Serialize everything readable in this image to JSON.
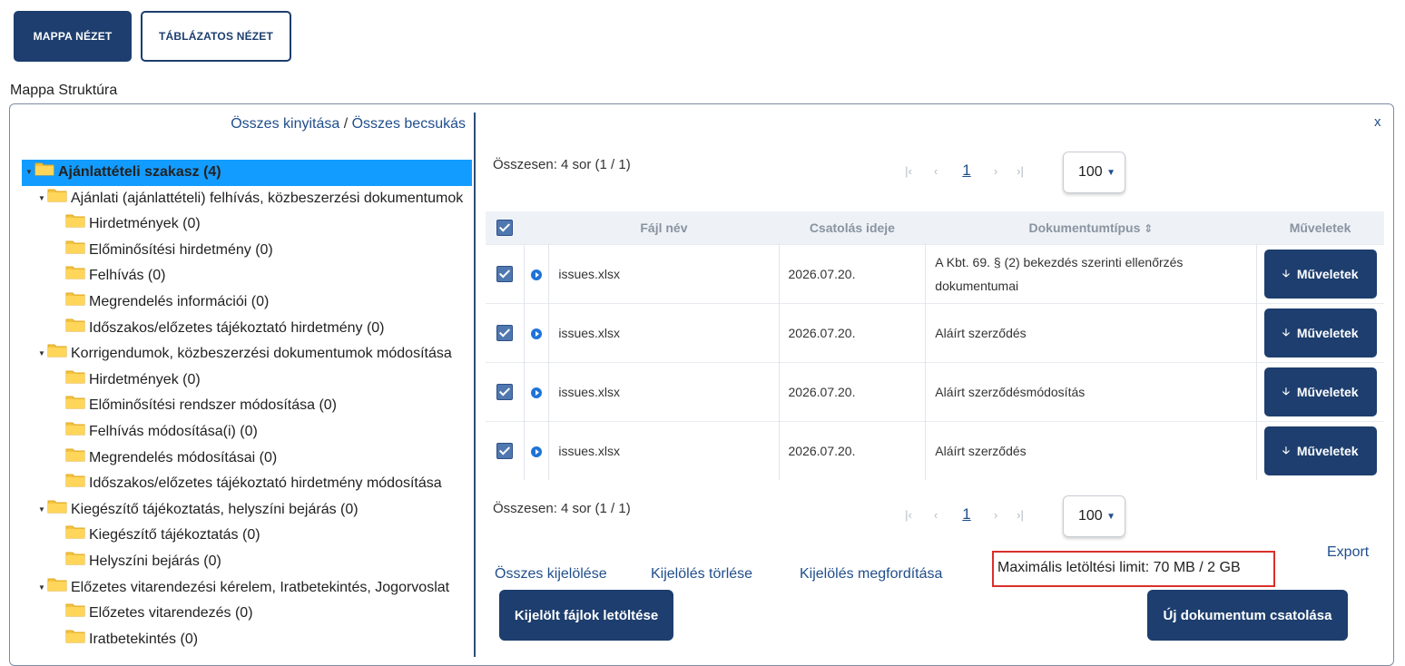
{
  "view_buttons": {
    "folder_view": "MAPPA NÉZET",
    "table_view": "TÁBLÁZATOS NÉZET"
  },
  "structure_label": "Mappa Struktúra",
  "tree_controls": {
    "expand_all": "Összes kinyitása",
    "separator": " / ",
    "collapse_all": "Összes becsukás"
  },
  "tree": [
    {
      "label": "Ajánlattételi szakasz (4)",
      "level": 0,
      "selected": true,
      "caret": true
    },
    {
      "label": "Ajánlati (ajánlattételi) felhívás, közbeszerzési dokumentumok",
      "level": 1,
      "caret": true
    },
    {
      "label": "Hirdetmények (0)",
      "level": 2
    },
    {
      "label": "Előminősítési hirdetmény (0)",
      "level": 2
    },
    {
      "label": "Felhívás (0)",
      "level": 2
    },
    {
      "label": "Megrendelés információi (0)",
      "level": 2
    },
    {
      "label": "Időszakos/előzetes tájékoztató hirdetmény (0)",
      "level": 2
    },
    {
      "label": "Korrigendumok, közbeszerzési dokumentumok módosítása",
      "level": 1,
      "caret": true
    },
    {
      "label": "Hirdetmények (0)",
      "level": 2
    },
    {
      "label": "Előminősítési rendszer módosítása (0)",
      "level": 2
    },
    {
      "label": "Felhívás módosítása(i) (0)",
      "level": 2
    },
    {
      "label": "Megrendelés módosításai (0)",
      "level": 2
    },
    {
      "label": "Időszakos/előzetes tájékoztató hirdetmény módosítása",
      "level": 2
    },
    {
      "label": "Kiegészítő tájékoztatás, helyszíni bejárás (0)",
      "level": 1,
      "caret": true
    },
    {
      "label": "Kiegészítő tájékoztatás (0)",
      "level": 2
    },
    {
      "label": "Helyszíni bejárás (0)",
      "level": 2
    },
    {
      "label": "Előzetes vitarendezési kérelem, Iratbetekintés, Jogorvoslat",
      "level": 1,
      "caret": true
    },
    {
      "label": "Előzetes vitarendezés (0)",
      "level": 2
    },
    {
      "label": "Iratbetekintés (0)",
      "level": 2
    }
  ],
  "close_label": "x",
  "summary": "Összesen: 4 sor (1 / 1)",
  "pager": {
    "first": "|‹",
    "prev": "‹",
    "page": "1",
    "next": "›",
    "last": "›|",
    "per_page": "100"
  },
  "table": {
    "headers": {
      "file_name": "Fájl név",
      "attached": "Csatolás ideje",
      "doc_type": "Dokumentumtípus",
      "actions": "Műveletek"
    },
    "sort_icon": "⇕",
    "rows": [
      {
        "file": "issues.xlsx",
        "date": "2026.07.20.",
        "type_line1": "A Kbt. 69. § (2) bekezdés szerinti ellenőrzés",
        "type_line2": "dokumentumai",
        "action": "Műveletek"
      },
      {
        "file": "issues.xlsx",
        "date": "2026.07.20.",
        "type_line1": "Aláírt szerződés",
        "type_line2": "",
        "action": "Műveletek"
      },
      {
        "file": "issues.xlsx",
        "date": "2026.07.20.",
        "type_line1": "Aláírt szerződésmódosítás",
        "type_line2": "",
        "action": "Műveletek"
      },
      {
        "file": "issues.xlsx",
        "date": "2026.07.20.",
        "type_line1": "Aláírt szerződés",
        "type_line2": "",
        "action": "Műveletek"
      }
    ]
  },
  "selection": {
    "select_all": "Összes kijelölése",
    "clear": "Kijelölés törlése",
    "invert": "Kijelölés megfordítása"
  },
  "limit_text": "Maximális letöltési limit: 70 MB / 2 GB",
  "export_label": "Export",
  "download_selected": "Kijelölt fájlok letöltése",
  "attach_new": "Új dokumentum csatolása"
}
